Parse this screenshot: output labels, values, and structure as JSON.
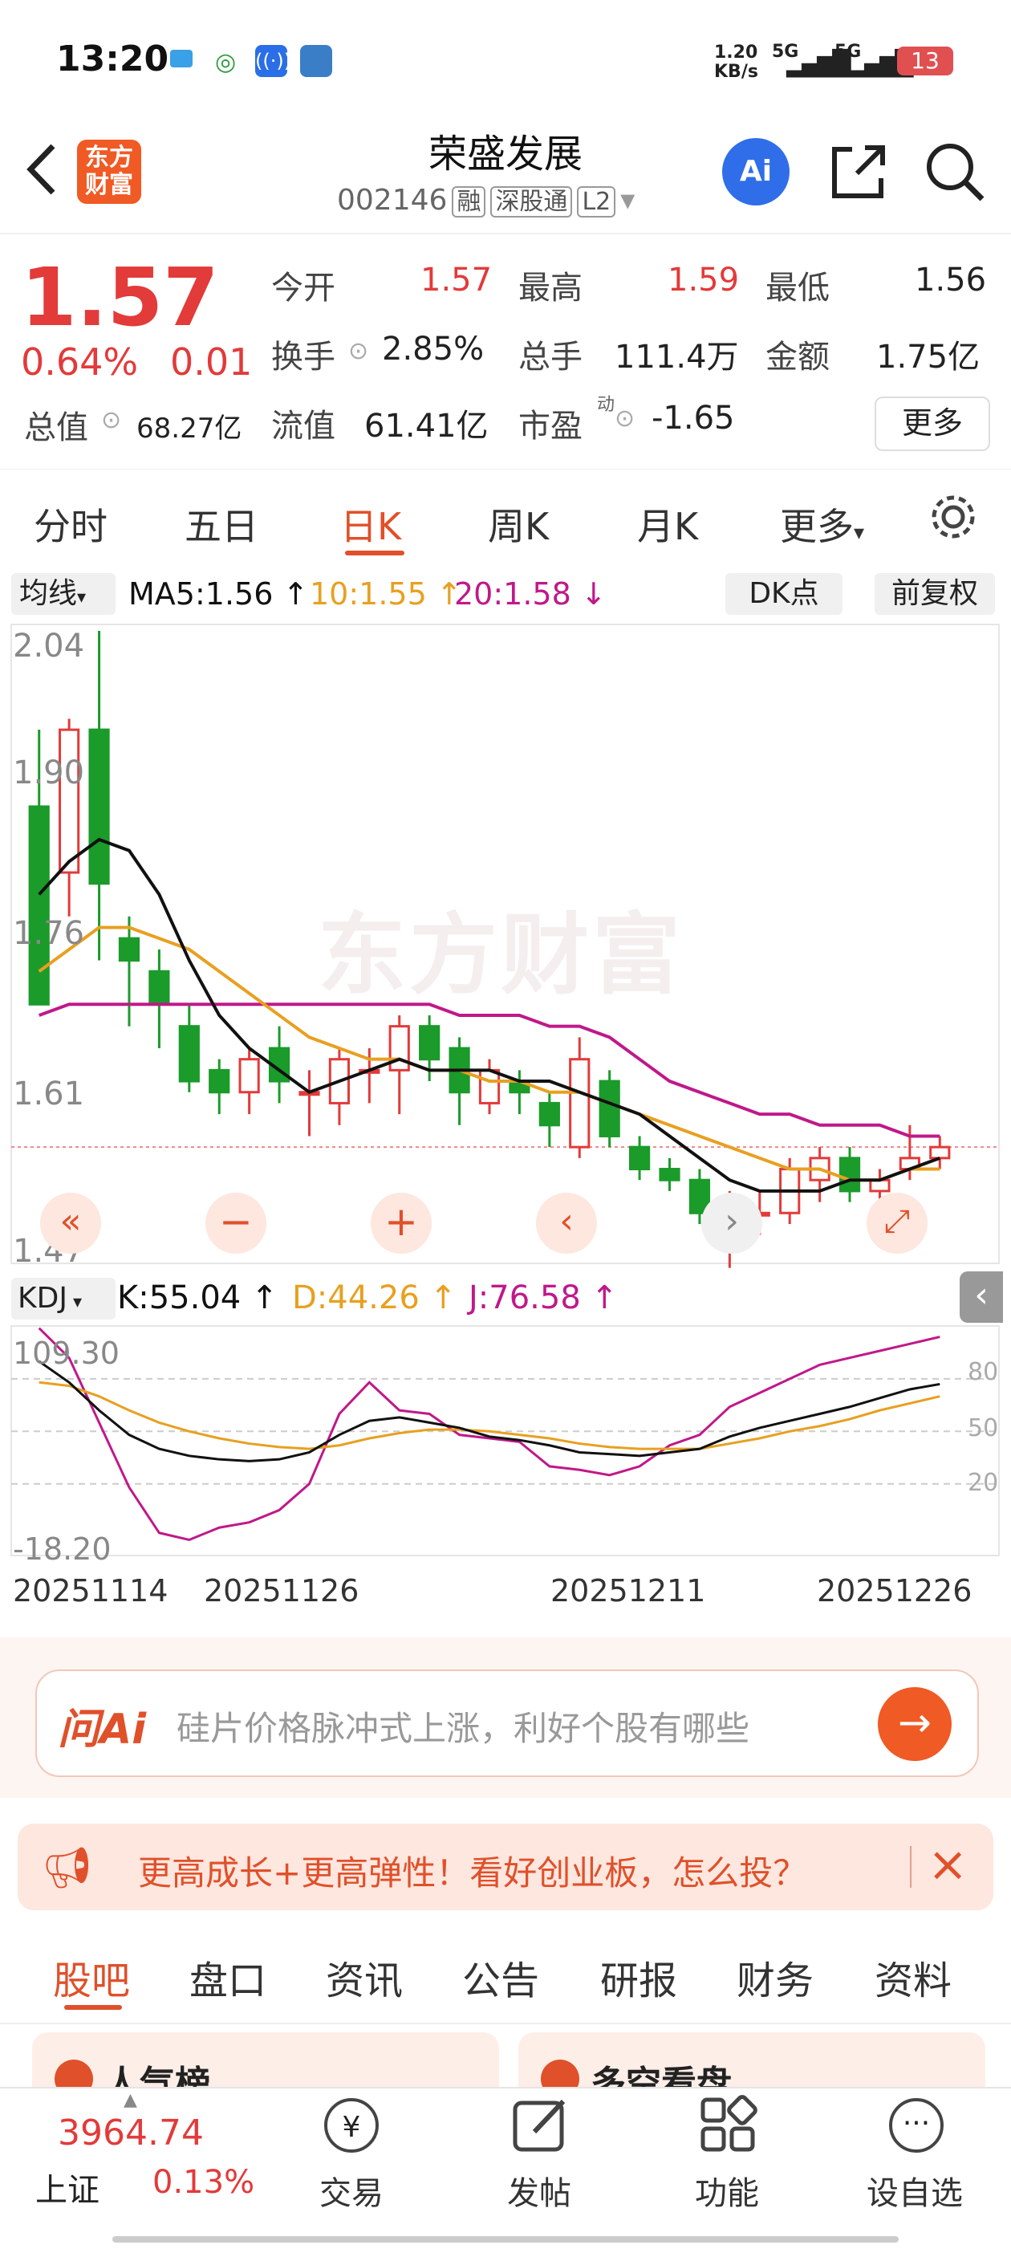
{
  "status": {
    "time": "13:20",
    "net_speed": "1.20\nKB/s",
    "net1": "5G",
    "net2": "5G",
    "battery": "13"
  },
  "header": {
    "logo_text": "东方\n财富",
    "stock_name": "荣盛发展",
    "stock_code": "002146",
    "tags": [
      "融",
      "深股通",
      "L2"
    ]
  },
  "quote": {
    "price": "1.57",
    "change_pct": "0.64%",
    "change": "0.01",
    "open_label": "今开",
    "open": "1.57",
    "high_label": "最高",
    "high": "1.59",
    "low_label": "最低",
    "low": "1.56",
    "turnover_label": "换手",
    "turnover": "2.85%",
    "volume_label": "总手",
    "volume": "111.4万",
    "amount_label": "金额",
    "amount": "1.75亿",
    "mktcap_label": "总值",
    "mktcap": "68.27亿",
    "float_label": "流值",
    "float": "61.41亿",
    "pe_label": "市盈",
    "pe_sup": "动",
    "pe": "-1.65",
    "more": "更多"
  },
  "tabs": [
    "分时",
    "五日",
    "日K",
    "周K",
    "月K",
    "更多"
  ],
  "active_tab": "日K",
  "ma_bar": {
    "selector": "均线",
    "ma5": "MA5:1.56 ↑",
    "ma10": "10:1.55 ↑",
    "ma20": "20:1.58 ↓",
    "dk": "DK点",
    "adj": "前复权"
  },
  "kline": {
    "y_labels": [
      "2.04",
      "1.90",
      "1.76",
      "1.61",
      "1.47"
    ],
    "watermark": "东方财富",
    "colors": {
      "up": "#e33a3a",
      "down": "#1a9b2a",
      "ma5": "#111111",
      "ma10": "#e8a020",
      "ma20": "#c0188a"
    }
  },
  "kdj_bar": {
    "selector": "KDJ",
    "k": "K:55.04 ↑",
    "d": "D:44.26 ↑",
    "j": "J:76.58 ↑"
  },
  "kdj": {
    "y_top": "109.30",
    "y_bottom": "-18.20",
    "levels": [
      "80",
      "50",
      "20"
    ]
  },
  "dates": [
    "20251114",
    "20251126",
    "20251211",
    "20251226"
  ],
  "ask": {
    "logo": "问Ai",
    "placeholder": "硅片价格脉冲式上涨，利好个股有哪些"
  },
  "banner": {
    "text": "更高成长+更高弹性！看好创业板，怎么投？"
  },
  "bottom_tabs": [
    "股吧",
    "盘口",
    "资讯",
    "公告",
    "研报",
    "财务",
    "资料"
  ],
  "cards": [
    "人气榜",
    "多空看盘"
  ],
  "index": {
    "value": "3964.74",
    "name": "上证",
    "pct": "0.13%"
  },
  "bottom_nav": [
    "交易",
    "发帖",
    "功能",
    "设自选"
  ],
  "chart_data": {
    "type": "candlestick",
    "title": "",
    "ylim": [
      1.47,
      2.04
    ],
    "candles": [
      {
        "o": 1.88,
        "h": 1.95,
        "l": 1.7,
        "c": 1.7
      },
      {
        "o": 1.82,
        "h": 1.96,
        "l": 1.78,
        "c": 1.95
      },
      {
        "o": 1.95,
        "h": 2.04,
        "l": 1.74,
        "c": 1.81
      },
      {
        "o": 1.76,
        "h": 1.78,
        "l": 1.68,
        "c": 1.74
      },
      {
        "o": 1.73,
        "h": 1.75,
        "l": 1.66,
        "c": 1.7
      },
      {
        "o": 1.68,
        "h": 1.7,
        "l": 1.62,
        "c": 1.63
      },
      {
        "o": 1.64,
        "h": 1.65,
        "l": 1.6,
        "c": 1.62
      },
      {
        "o": 1.62,
        "h": 1.66,
        "l": 1.6,
        "c": 1.65
      },
      {
        "o": 1.66,
        "h": 1.68,
        "l": 1.61,
        "c": 1.63
      },
      {
        "o": 1.62,
        "h": 1.64,
        "l": 1.58,
        "c": 1.62
      },
      {
        "o": 1.61,
        "h": 1.66,
        "l": 1.59,
        "c": 1.65
      },
      {
        "o": 1.64,
        "h": 1.66,
        "l": 1.61,
        "c": 1.64
      },
      {
        "o": 1.64,
        "h": 1.69,
        "l": 1.6,
        "c": 1.68
      },
      {
        "o": 1.68,
        "h": 1.69,
        "l": 1.63,
        "c": 1.65
      },
      {
        "o": 1.66,
        "h": 1.67,
        "l": 1.59,
        "c": 1.62
      },
      {
        "o": 1.61,
        "h": 1.65,
        "l": 1.6,
        "c": 1.64
      },
      {
        "o": 1.63,
        "h": 1.64,
        "l": 1.6,
        "c": 1.62
      },
      {
        "o": 1.61,
        "h": 1.62,
        "l": 1.57,
        "c": 1.59
      },
      {
        "o": 1.57,
        "h": 1.67,
        "l": 1.56,
        "c": 1.65
      },
      {
        "o": 1.63,
        "h": 1.64,
        "l": 1.57,
        "c": 1.58
      },
      {
        "o": 1.57,
        "h": 1.58,
        "l": 1.54,
        "c": 1.55
      },
      {
        "o": 1.55,
        "h": 1.56,
        "l": 1.53,
        "c": 1.54
      },
      {
        "o": 1.54,
        "h": 1.55,
        "l": 1.5,
        "c": 1.51
      },
      {
        "o": 1.5,
        "h": 1.53,
        "l": 1.46,
        "c": 1.51
      },
      {
        "o": 1.51,
        "h": 1.53,
        "l": 1.49,
        "c": 1.51
      },
      {
        "o": 1.51,
        "h": 1.56,
        "l": 1.5,
        "c": 1.55
      },
      {
        "o": 1.54,
        "h": 1.57,
        "l": 1.52,
        "c": 1.56
      },
      {
        "o": 1.56,
        "h": 1.57,
        "l": 1.52,
        "c": 1.53
      },
      {
        "o": 1.53,
        "h": 1.55,
        "l": 1.51,
        "c": 1.54
      },
      {
        "o": 1.55,
        "h": 1.59,
        "l": 1.54,
        "c": 1.56
      },
      {
        "o": 1.56,
        "h": 1.58,
        "l": 1.55,
        "c": 1.57
      }
    ],
    "ma5": [
      1.8,
      1.83,
      1.85,
      1.84,
      1.8,
      1.74,
      1.69,
      1.66,
      1.64,
      1.62,
      1.63,
      1.64,
      1.65,
      1.64,
      1.64,
      1.64,
      1.63,
      1.63,
      1.62,
      1.61,
      1.6,
      1.58,
      1.56,
      1.54,
      1.53,
      1.53,
      1.53,
      1.54,
      1.54,
      1.55,
      1.56
    ],
    "ma10": [
      1.73,
      1.75,
      1.77,
      1.77,
      1.76,
      1.75,
      1.73,
      1.71,
      1.69,
      1.67,
      1.66,
      1.65,
      1.65,
      1.64,
      1.64,
      1.63,
      1.63,
      1.62,
      1.62,
      1.61,
      1.6,
      1.59,
      1.58,
      1.57,
      1.56,
      1.55,
      1.55,
      1.54,
      1.54,
      1.55,
      1.55
    ],
    "ma20": [
      1.69,
      1.7,
      1.7,
      1.7,
      1.7,
      1.7,
      1.7,
      1.7,
      1.7,
      1.7,
      1.7,
      1.7,
      1.7,
      1.7,
      1.69,
      1.69,
      1.69,
      1.68,
      1.68,
      1.67,
      1.65,
      1.63,
      1.62,
      1.61,
      1.6,
      1.6,
      1.59,
      1.59,
      1.59,
      1.58,
      1.58
    ],
    "kdj_range": [
      -18.2,
      109.3
    ],
    "K": [
      90,
      78,
      62,
      48,
      40,
      36,
      34,
      33,
      34,
      38,
      48,
      56,
      58,
      55,
      52,
      47,
      45,
      42,
      38,
      37,
      36,
      38,
      40,
      47,
      52,
      56,
      60,
      64,
      69,
      74,
      77
    ],
    "D": [
      78,
      76,
      70,
      62,
      55,
      50,
      46,
      43,
      41,
      40,
      42,
      46,
      49,
      51,
      51,
      50,
      48,
      46,
      43,
      41,
      40,
      40,
      40,
      43,
      46,
      50,
      53,
      57,
      62,
      66,
      70
    ],
    "J": [
      109,
      92,
      55,
      18,
      -8,
      -12,
      -5,
      -2,
      5,
      20,
      60,
      78,
      62,
      60,
      48,
      46,
      44,
      30,
      28,
      25,
      30,
      42,
      48,
      64,
      72,
      80,
      88,
      92,
      96,
      100,
      104
    ]
  }
}
